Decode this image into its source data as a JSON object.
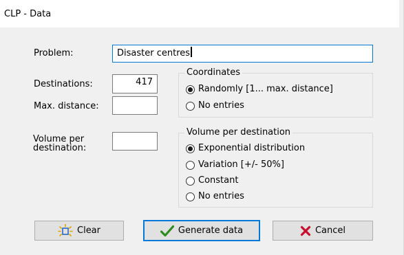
{
  "window": {
    "title": "CLP - Data"
  },
  "problem": {
    "label": "Problem:",
    "value": "Disaster centres"
  },
  "destinations": {
    "label": "Destinations:",
    "value": "417"
  },
  "max_distance": {
    "label": "Max. distance:",
    "value": ""
  },
  "volume": {
    "label_line1": "Volume per",
    "label_line2": "destination:",
    "value": ""
  },
  "coordinates": {
    "title": "Coordinates",
    "options": [
      {
        "label": "Randomly  [1... max. distance]",
        "checked": true
      },
      {
        "label": "No entries",
        "checked": false
      }
    ]
  },
  "volume_per_destination": {
    "title": "Volume per destination",
    "options": [
      {
        "label": "Exponential distribution",
        "checked": true
      },
      {
        "label": "Variation [+/- 50%]",
        "checked": false
      },
      {
        "label": "Constant",
        "checked": false
      },
      {
        "label": "No entries",
        "checked": false
      }
    ]
  },
  "buttons": {
    "clear": "Clear",
    "generate": "Generate data",
    "cancel": "Cancel"
  },
  "colors": {
    "focus_border": "#0078d7",
    "check_green": "#2e8b1f",
    "cancel_red": "#c8102e"
  },
  "icons": {
    "clear": "sparkle-box-icon",
    "generate": "checkmark-icon",
    "cancel": "x-icon"
  }
}
